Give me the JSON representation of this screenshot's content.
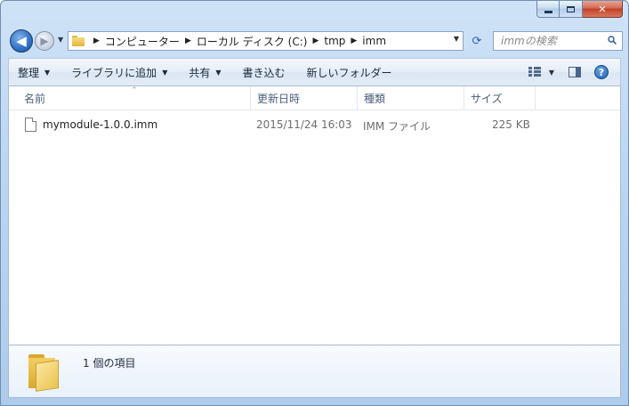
{
  "window": {
    "caption_buttons": {
      "minimize": "minimize",
      "maximize": "maximize",
      "close": "✕"
    }
  },
  "nav": {
    "back_glyph": "◀",
    "forward_glyph": "▶",
    "history_glyph": "▼",
    "breadcrumbs": [
      "コンピューター",
      "ローカル ディスク (C:)",
      "tmp",
      "imm"
    ],
    "address_dropdown_glyph": "▼",
    "refresh_glyph": "⟳"
  },
  "search": {
    "placeholder": "immの検索"
  },
  "toolbar": {
    "organize": "整理",
    "add_to_library": "ライブラリに追加",
    "share": "共有",
    "burn": "書き込む",
    "new_folder": "新しいフォルダー",
    "dropdown_glyph": "▼",
    "help": "?"
  },
  "columns": {
    "name": "名前",
    "date_modified": "更新日時",
    "type": "種類",
    "size": "サイズ",
    "sort_glyph": "^"
  },
  "files": [
    {
      "name": "mymodule-1.0.0.imm",
      "date": "2015/11/24 16:03",
      "type": "IMM ファイル",
      "size": "225 KB"
    }
  ],
  "details": {
    "item_count": "1 個の項目"
  },
  "colors": {
    "accent": "#2f6fc2",
    "close": "#c2412a",
    "frame": "#bcd6f1"
  }
}
